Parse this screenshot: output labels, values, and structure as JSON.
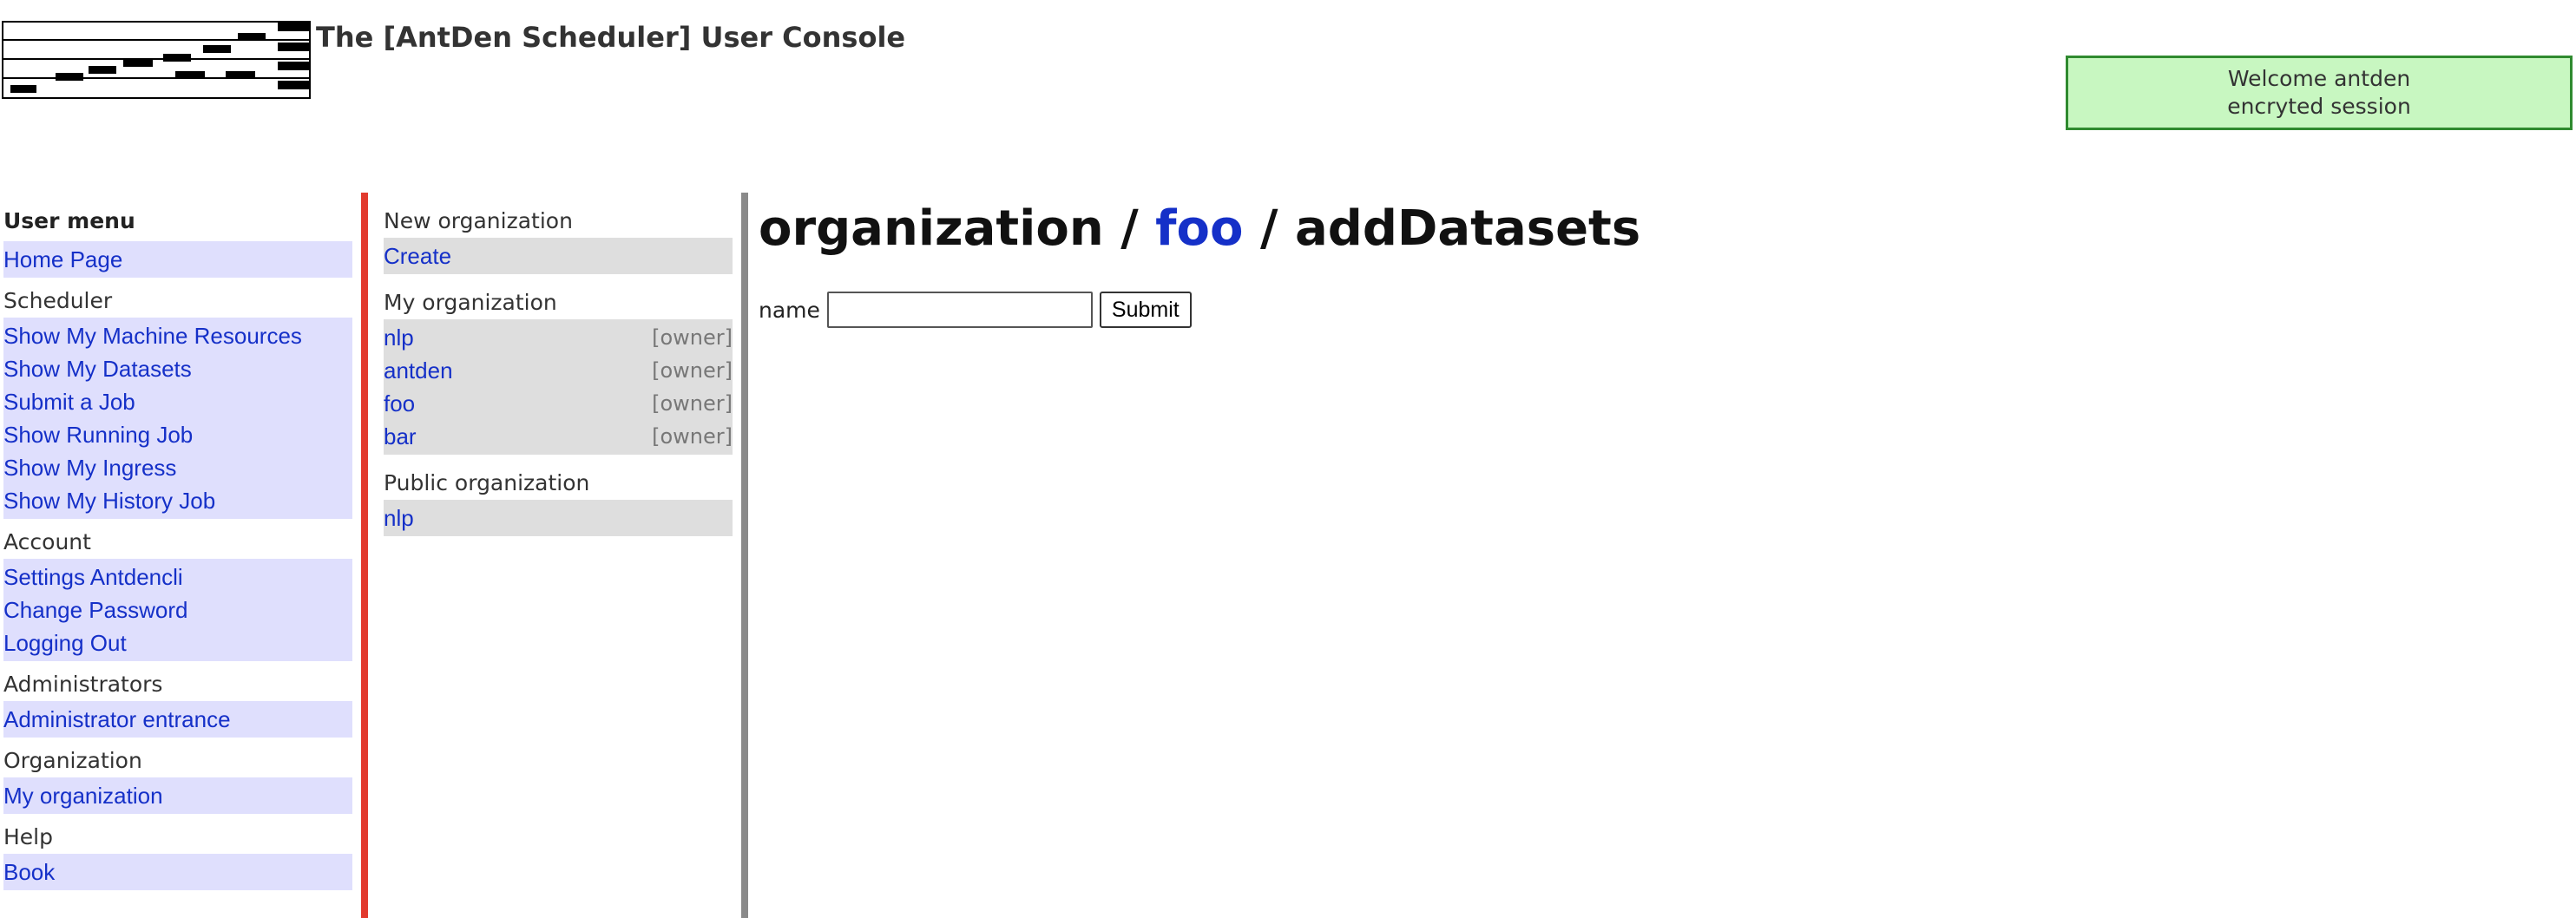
{
  "header": {
    "title": "The [AntDen Scheduler] User Console",
    "logo_icon": "scheduler-gantt-logo",
    "welcome_line1": "Welcome antden",
    "welcome_line2": "encryted session"
  },
  "sidebar": {
    "title": "User menu",
    "home": "Home Page",
    "scheduler": {
      "heading": "Scheduler",
      "items": [
        "Show My Machine Resources",
        "Show My Datasets",
        "Submit a Job",
        "Show Running Job",
        "Show My Ingress",
        "Show My History Job"
      ]
    },
    "account": {
      "heading": "Account",
      "items": [
        "Settings Antdencli",
        "Change Password",
        "Logging Out"
      ]
    },
    "administrators": {
      "heading": "Administrators",
      "items": [
        "Administrator entrance"
      ]
    },
    "organization": {
      "heading": "Organization",
      "items": [
        "My organization"
      ]
    },
    "help": {
      "heading": "Help",
      "items": [
        "Book"
      ]
    }
  },
  "org_panel": {
    "new_heading": "New organization",
    "create": "Create",
    "my_heading": "My organization",
    "my_orgs": [
      {
        "name": "nlp",
        "role": "[owner]"
      },
      {
        "name": "antden",
        "role": "[owner]"
      },
      {
        "name": "foo",
        "role": "[owner]"
      },
      {
        "name": "bar",
        "role": "[owner]"
      }
    ],
    "public_heading": "Public organization",
    "public_orgs": [
      "nlp"
    ]
  },
  "main": {
    "crumb_1": "organization",
    "separator": "/",
    "crumb_2": "foo",
    "crumb_3": "addDatasets",
    "form": {
      "name_label": "name",
      "name_value": "",
      "submit_label": "Submit"
    }
  },
  "colors": {
    "link": "#1530c8",
    "welcome_bg": "#c8f7c1",
    "welcome_border": "#2f8a2f",
    "menu_bg": "#dfdffd",
    "org_bg": "#dedede",
    "red_divider": "#e23a2e",
    "gray_divider": "#8a8a8a"
  }
}
